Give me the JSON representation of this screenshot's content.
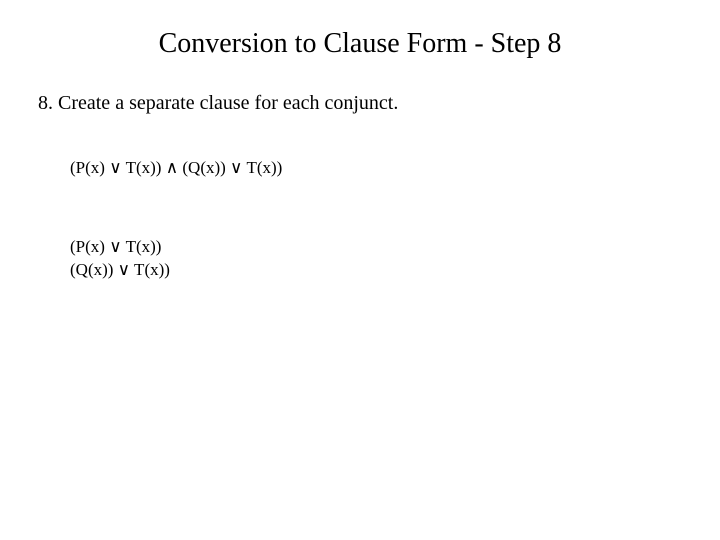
{
  "slide": {
    "title": "Conversion to Clause Form - Step 8",
    "body": "8. Create a separate clause for each conjunct.",
    "formula_combined": "(P(x) ∨ T(x)) ∧ (Q(x)) ∨ T(x))",
    "formula_sep_line1": "(P(x) ∨ T(x))",
    "formula_sep_line2": "(Q(x)) ∨ T(x))"
  }
}
